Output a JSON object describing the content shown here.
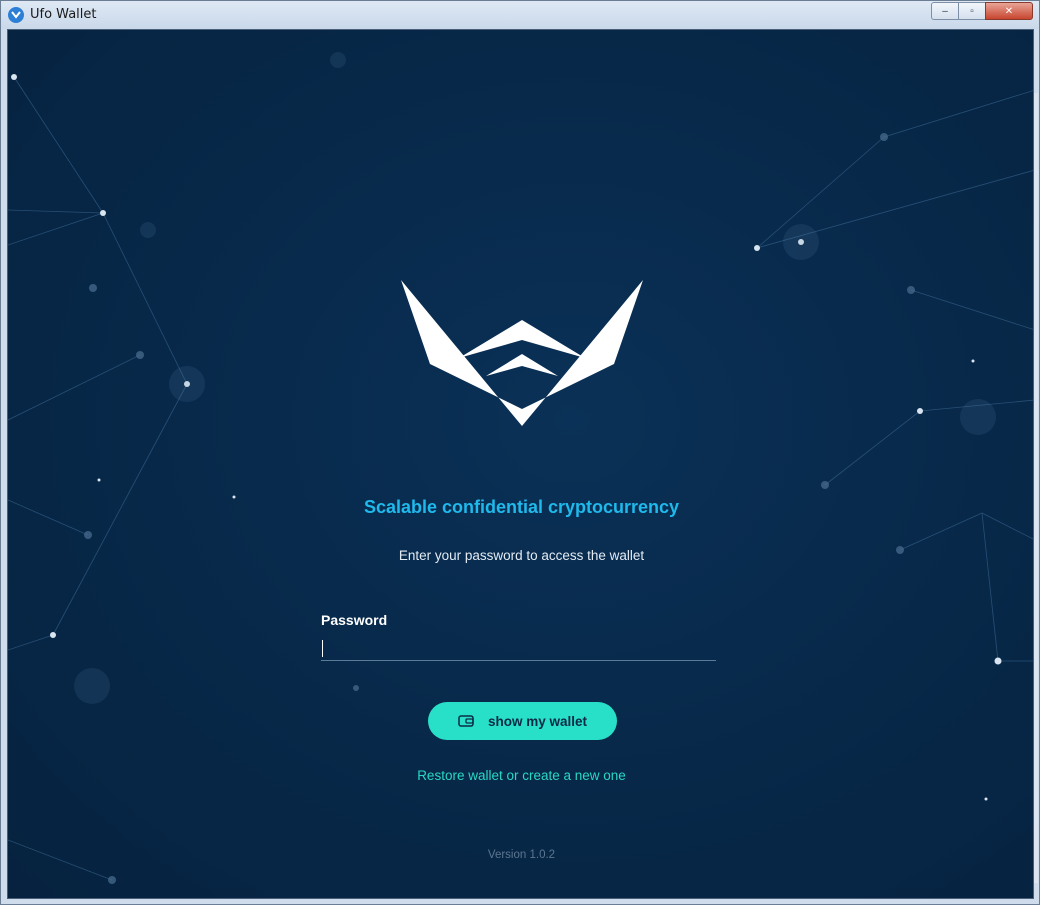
{
  "window": {
    "title": "Ufo Wallet",
    "controls": {
      "minimize": "–",
      "maximize": "▫",
      "close": "✕"
    }
  },
  "main": {
    "tagline": "Scalable confidential cryptocurrency",
    "subtitle": "Enter your password to access the wallet",
    "password": {
      "label": "Password",
      "value": "",
      "placeholder": ""
    },
    "primary_button": {
      "label": "show my wallet",
      "icon": "wallet-icon"
    },
    "restore_link": "Restore wallet or create a new one",
    "version": "Version 1.0.2"
  },
  "colors": {
    "background": "#082a4c",
    "accent": "#28e0c8",
    "tagline": "#1fb9ec",
    "close_button": "#c8452f"
  }
}
